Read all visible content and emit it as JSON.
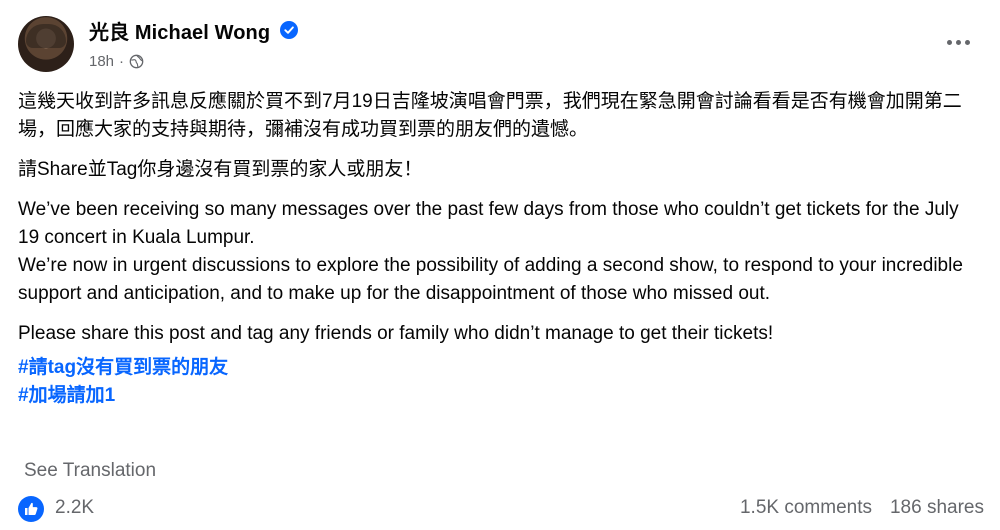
{
  "post": {
    "author": "光良 Michael Wong",
    "time": "18h",
    "separator": "·",
    "paragraphs": [
      "這幾天收到許多訊息反應關於買不到7月19日吉隆坡演唱會門票，我們現在緊急開會討論看看是否有機會加開第二場，回應大家的支持與期待，彌補沒有成功買到票的朋友們的遺憾。",
      "請Share並Tag你身邊沒有買到票的家人或朋友！",
      "We’ve been receiving so many messages over the past few days from those who couldn’t get tickets for the July 19 concert in Kuala Lumpur.",
      "We’re now in urgent discussions to explore the possibility of adding a second show, to respond to your incredible support and anticipation, and to make up for the disappointment of those who missed out.",
      "Please share this post and tag any friends or family who didn’t manage to get their tickets!"
    ],
    "hashtags": [
      "#請tag沒有買到票的朋友",
      "#加場請加1"
    ],
    "see_translation": "See Translation"
  },
  "engagement": {
    "likes": "2.2K",
    "comments": "1.5K comments",
    "shares": "186 shares"
  },
  "icons": {
    "verified": "verified-badge-icon",
    "privacy": "globe-icon",
    "more": "more-options-icon",
    "like": "like-icon"
  },
  "colors": {
    "accent": "#0866ff",
    "muted": "#65676b",
    "text": "#050505"
  }
}
